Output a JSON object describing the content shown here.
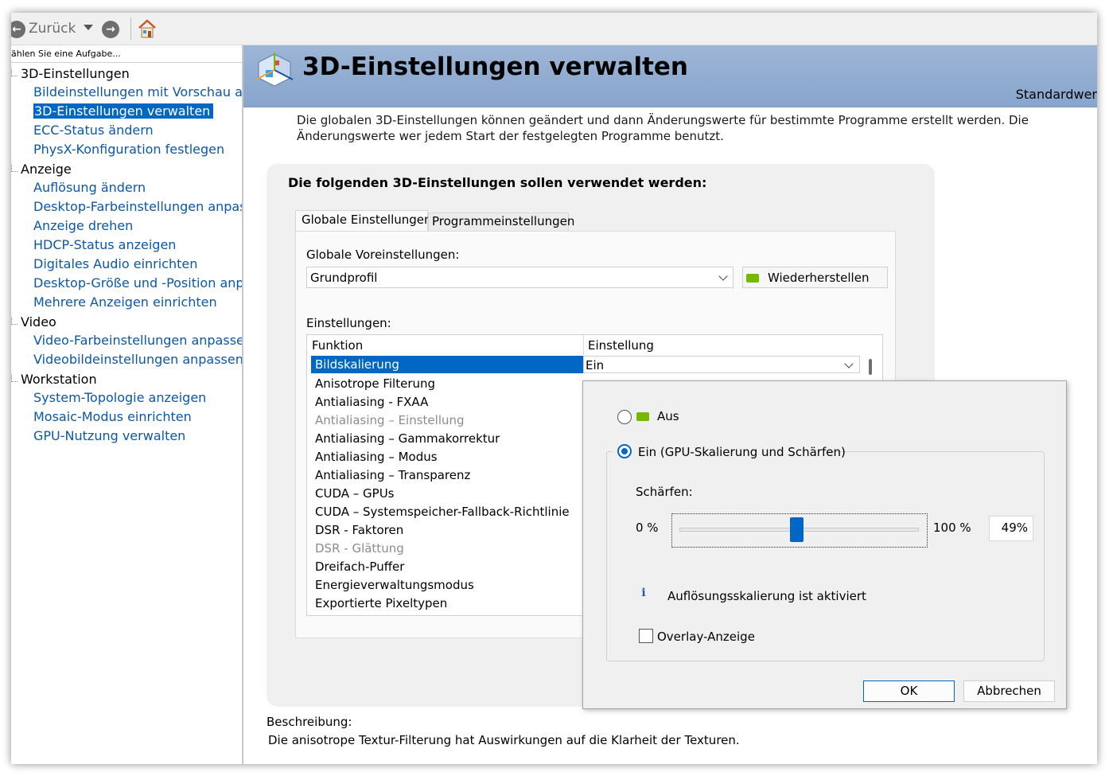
{
  "toolbar": {
    "back_label": "Zurück",
    "back_icon": "back-arrow-icon",
    "forward_icon": "forward-arrow-icon",
    "home_icon": "home-icon"
  },
  "left_panel": {
    "task_prompt": "ählen Sie eine Aufgabe...",
    "categories": [
      {
        "label": "3D-Einstellungen",
        "items": [
          "Bildeinstellungen mit Vorschau anpas",
          "3D-Einstellungen verwalten",
          "ECC-Status ändern",
          "PhysX-Konfiguration festlegen"
        ]
      },
      {
        "label": "Anzeige",
        "items": [
          "Auflösung ändern",
          "Desktop-Farbeinstellungen anpassen",
          "Anzeige drehen",
          "HDCP-Status anzeigen",
          "Digitales Audio einrichten",
          "Desktop-Größe und -Position anpass",
          "Mehrere Anzeigen einrichten"
        ]
      },
      {
        "label": "Video",
        "items": [
          "Video-Farbeinstellungen anpassen",
          "Videobildeinstellungen anpassen"
        ]
      },
      {
        "label": "Workstation",
        "items": [
          "System-Topologie anzeigen",
          "Mosaic-Modus einrichten",
          "GPU-Nutzung verwalten"
        ]
      }
    ],
    "selected_item": "3D-Einstellungen verwalten"
  },
  "banner": {
    "title": "3D-Einstellungen verwalten",
    "right_text": "Standardwer"
  },
  "intro_text": "Die globalen 3D-Einstellungen können geändert und dann Änderungswerte für bestimmte Programme erstellt werden. Die Änderungswerte wer jedem Start der festgelegten Programme benutzt.",
  "settings_group": {
    "title": "Die folgenden 3D-Einstellungen sollen verwendet werden:",
    "tabs": [
      {
        "label": "Globale Einstellungen",
        "active": true
      },
      {
        "label": "Programmeinstellungen",
        "active": false
      }
    ],
    "preset_label": "Globale Voreinstellungen:",
    "preset_value": "Grundprofil",
    "restore_button": "Wiederherstellen",
    "settings_label": "Einstellungen:",
    "columns": [
      "Funktion",
      "Einstellung"
    ],
    "rows": [
      {
        "name": "Bildskalierung",
        "value": "Ein",
        "selected": true
      },
      {
        "name": "Anisotrope Filterung"
      },
      {
        "name": "Antialiasing - FXAA"
      },
      {
        "name": "Antialiasing – Einstellung",
        "disabled": true
      },
      {
        "name": "Antialiasing – Gammakorrektur"
      },
      {
        "name": "Antialiasing – Modus"
      },
      {
        "name": "Antialiasing – Transparenz"
      },
      {
        "name": "CUDA – GPUs"
      },
      {
        "name": "CUDA – Systemspeicher-Fallback-Richtlinie"
      },
      {
        "name": "DSR - Faktoren"
      },
      {
        "name": "DSR - Glättung",
        "disabled": true
      },
      {
        "name": "Dreifach-Puffer"
      },
      {
        "name": "Energieverwaltungsmodus"
      },
      {
        "name": "Exportierte Pixeltypen"
      }
    ]
  },
  "description": {
    "label": "Beschreibung:",
    "text": "Die anisotrope Textur-Filterung hat Auswirkungen auf die Klarheit der Texturen."
  },
  "popup": {
    "option_off": "Aus",
    "option_on": "Ein (GPU-Skalierung und Schärfen)",
    "selected_option": "on",
    "sharpen_label": "Schärfen:",
    "min_label": "0 %",
    "max_label": "100 %",
    "value_text": "49%",
    "value_fraction": 0.49,
    "info_text": "Auflösungsskalierung ist aktiviert",
    "overlay_label": "Overlay-Anzeige",
    "overlay_checked": false,
    "ok_button": "OK",
    "cancel_button": "Abbrechen"
  },
  "colors": {
    "accent": "#0067c5",
    "link": "#0b57a8",
    "banner": "#9db5d6",
    "nvidia_green": "#76b900"
  }
}
